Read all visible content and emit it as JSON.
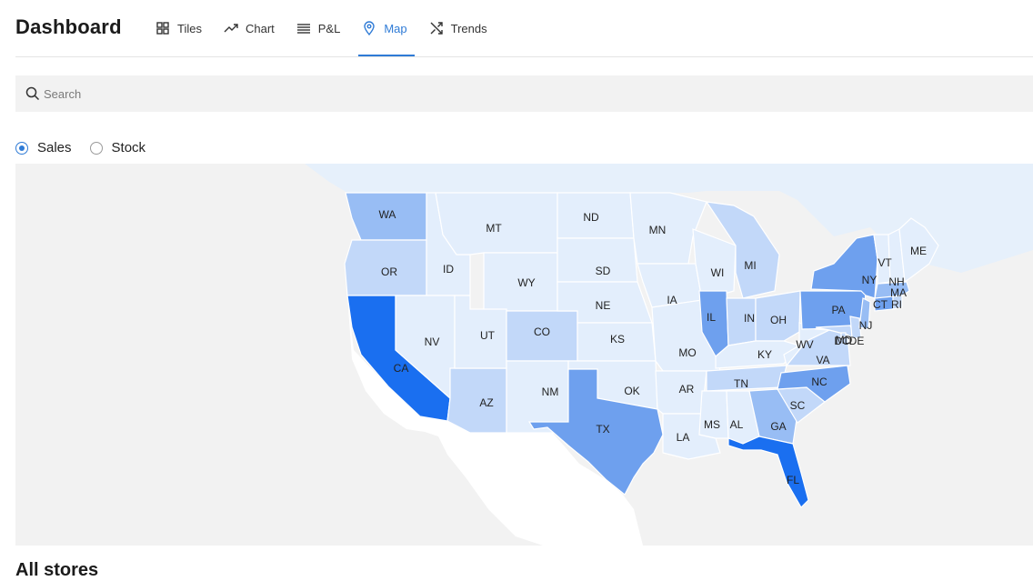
{
  "header": {
    "title": "Dashboard"
  },
  "tabs": [
    {
      "label": "Tiles",
      "icon": "tiles-icon",
      "active": false
    },
    {
      "label": "Chart",
      "icon": "trend-line-icon",
      "active": false
    },
    {
      "label": "P&L",
      "icon": "list-icon",
      "active": false
    },
    {
      "label": "Map",
      "icon": "map-pin-icon",
      "active": true
    },
    {
      "label": "Trends",
      "icon": "shuffle-icon",
      "active": false
    }
  ],
  "search": {
    "placeholder": "Search",
    "value": ""
  },
  "metric_options": [
    {
      "label": "Sales",
      "checked": true
    },
    {
      "label": "Stock",
      "checked": false
    }
  ],
  "colors": {
    "accent": "#2f7bd6",
    "level_0": "#e3eefc",
    "level_1": "#c2d8f9",
    "level_2": "#98bdf4",
    "level_3": "#6ea0ee",
    "level_4": "#1a6ff0",
    "land": "#f2f2f2",
    "canada": "#e6f0fb",
    "mexico": "#ffffff"
  },
  "map": {
    "states": [
      {
        "code": "WA",
        "level": 2
      },
      {
        "code": "OR",
        "level": 1
      },
      {
        "code": "CA",
        "level": 4
      },
      {
        "code": "ID",
        "level": 0
      },
      {
        "code": "NV",
        "level": 0
      },
      {
        "code": "AZ",
        "level": 1
      },
      {
        "code": "MT",
        "level": 0
      },
      {
        "code": "WY",
        "level": 0
      },
      {
        "code": "UT",
        "level": 0
      },
      {
        "code": "CO",
        "level": 1
      },
      {
        "code": "NM",
        "level": 0
      },
      {
        "code": "ND",
        "level": 0
      },
      {
        "code": "SD",
        "level": 0
      },
      {
        "code": "NE",
        "level": 0
      },
      {
        "code": "KS",
        "level": 0
      },
      {
        "code": "OK",
        "level": 0
      },
      {
        "code": "TX",
        "level": 3
      },
      {
        "code": "MN",
        "level": 0
      },
      {
        "code": "IA",
        "level": 0
      },
      {
        "code": "MO",
        "level": 0
      },
      {
        "code": "AR",
        "level": 0
      },
      {
        "code": "LA",
        "level": 0
      },
      {
        "code": "WI",
        "level": 0
      },
      {
        "code": "IL",
        "level": 3
      },
      {
        "code": "MI",
        "level": 1
      },
      {
        "code": "IN",
        "level": 1
      },
      {
        "code": "OH",
        "level": 1
      },
      {
        "code": "KY",
        "level": 0
      },
      {
        "code": "TN",
        "level": 1
      },
      {
        "code": "MS",
        "level": 0
      },
      {
        "code": "AL",
        "level": 0
      },
      {
        "code": "GA",
        "level": 2
      },
      {
        "code": "FL",
        "level": 4
      },
      {
        "code": "SC",
        "level": 1
      },
      {
        "code": "NC",
        "level": 3
      },
      {
        "code": "VA",
        "level": 1
      },
      {
        "code": "WV",
        "level": 0
      },
      {
        "code": "PA",
        "level": 3
      },
      {
        "code": "NY",
        "level": 3
      },
      {
        "code": "MD",
        "level": 1
      },
      {
        "code": "DE",
        "level": 1
      },
      {
        "code": "NJ",
        "level": 2
      },
      {
        "code": "CT",
        "level": 3
      },
      {
        "code": "RI",
        "level": 1
      },
      {
        "code": "MA",
        "level": 2
      },
      {
        "code": "VT",
        "level": 0
      },
      {
        "code": "NH",
        "level": 0
      },
      {
        "code": "ME",
        "level": 0
      },
      {
        "code": "DC",
        "level": 1
      }
    ]
  },
  "section": {
    "title": "All stores"
  }
}
